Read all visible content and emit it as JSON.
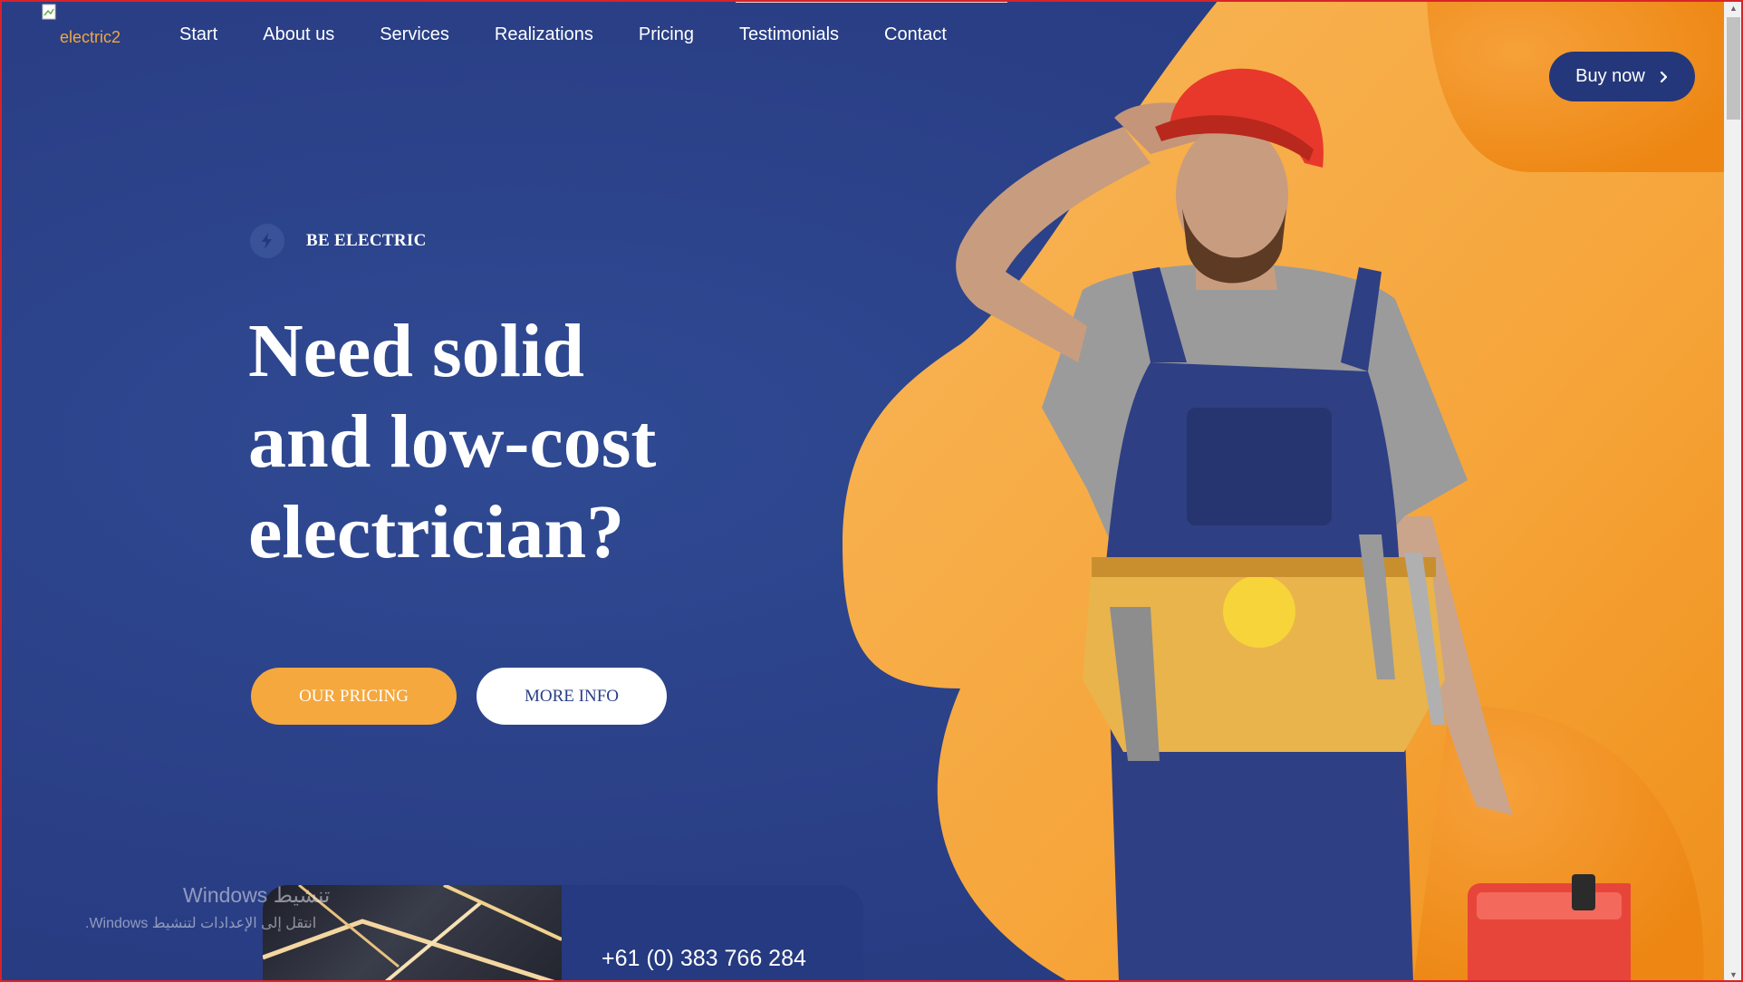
{
  "logo": {
    "alt_text": "electric2"
  },
  "nav": {
    "items": [
      {
        "label": "Start"
      },
      {
        "label": "About us"
      },
      {
        "label": "Services"
      },
      {
        "label": "Realizations"
      },
      {
        "label": "Pricing"
      },
      {
        "label": "Testimonials"
      },
      {
        "label": "Contact"
      }
    ]
  },
  "buy_button": {
    "label": "Buy now",
    "icon": "chevron-right-icon"
  },
  "hero": {
    "badge": {
      "icon": "lightning-bolt-icon",
      "label": "BE ELECTRIC"
    },
    "headline_lines": [
      "Need solid",
      "and low-cost",
      "electrician?"
    ],
    "primary_button": "OUR PRICING",
    "secondary_button": "MORE INFO"
  },
  "contact_card": {
    "phone": "+61 (0) 383 766 284"
  },
  "os_watermark": {
    "line1": "تنشيط Windows",
    "line2": "انتقل إلى الإعدادات لتنشيط Windows."
  },
  "colors": {
    "brand_blue": "#2b4189",
    "accent_orange": "#f5a83d",
    "deep_orange": "#ef8a12",
    "button_dark": "#24377a"
  }
}
